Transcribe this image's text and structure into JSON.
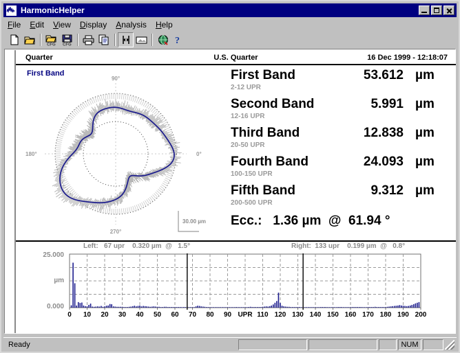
{
  "window": {
    "title": "HarmonicHelper",
    "icon": "waveform-app-icon",
    "buttons": {
      "minimize": "minimize",
      "maximize": "maximize",
      "close": "close"
    }
  },
  "menu": [
    {
      "label": "File",
      "accel": "F"
    },
    {
      "label": "Edit",
      "accel": "E"
    },
    {
      "label": "View",
      "accel": "V"
    },
    {
      "label": "Display",
      "accel": "D"
    },
    {
      "label": "Analysis",
      "accel": "A"
    },
    {
      "label": "Help",
      "accel": "H"
    }
  ],
  "toolbar": [
    {
      "name": "new-file-icon",
      "title": "New"
    },
    {
      "name": "open-file-icon",
      "title": "Open"
    },
    {
      "sep": true
    },
    {
      "name": "open-cfg-icon",
      "title": "Open CFG"
    },
    {
      "name": "save-cfg-icon",
      "title": "Save CFG"
    },
    {
      "sep": true
    },
    {
      "name": "print-icon",
      "title": "Print"
    },
    {
      "name": "copy-icon",
      "title": "Copy"
    },
    {
      "sep": true
    },
    {
      "name": "cursors-icon",
      "title": "Cursors",
      "pressed": true
    },
    {
      "name": "image-icon",
      "title": "Image"
    },
    {
      "sep": true
    },
    {
      "name": "globe-icon",
      "title": "Web"
    },
    {
      "name": "help-icon",
      "title": "Help"
    }
  ],
  "header": {
    "left": "Quarter",
    "center": "U.S. Quarter",
    "right": "16 Dec 1999 - 12:18:07"
  },
  "polar": {
    "title": "First Band",
    "angles": {
      "top": "90°",
      "left": "180°",
      "right": "0°",
      "bottom": "270°"
    },
    "scale_label": "30.00 µm"
  },
  "bands": [
    {
      "name": "First Band",
      "range": "2-12 UPR",
      "value": "53.612",
      "unit": "µm"
    },
    {
      "name": "Second Band",
      "range": "12-16 UPR",
      "value": "5.991",
      "unit": "µm"
    },
    {
      "name": "Third Band",
      "range": "20-50 UPR",
      "value": "12.838",
      "unit": "µm"
    },
    {
      "name": "Fourth Band",
      "range": "100-150 UPR",
      "value": "24.093",
      "unit": "µm"
    },
    {
      "name": "Fifth Band",
      "range": "200-500 UPR",
      "value": "9.312",
      "unit": "µm"
    }
  ],
  "eccentricity": "Ecc.:   1.36 µm  @  61.94 °",
  "spectrum": {
    "left_cursor_text": "Left:   67 upr    0.320 µm  @   1.5°",
    "right_cursor_text": "Right:  133 upr    0.199 µm  @   0.8°",
    "left_cursor_upr": 67,
    "right_cursor_upr": 133
  },
  "chart_data": {
    "type": "bar",
    "title": "Harmonic amplitude spectrum",
    "xlabel": "UPR",
    "ylabel": "µm",
    "xlim": [
      0,
      200
    ],
    "ylim": [
      0,
      25
    ],
    "yticks": [
      0.0,
      25.0
    ],
    "ytick_labels": [
      "0.000",
      "25.000"
    ],
    "xticks": [
      0,
      10,
      20,
      30,
      40,
      50,
      60,
      70,
      80,
      90,
      100,
      110,
      120,
      130,
      140,
      150,
      160,
      170,
      180,
      190,
      200
    ],
    "grid": true,
    "cursors": [
      67,
      133
    ],
    "x": [
      1,
      2,
      3,
      4,
      5,
      6,
      7,
      8,
      9,
      10,
      11,
      12,
      13,
      14,
      15,
      16,
      17,
      18,
      19,
      20,
      21,
      22,
      23,
      24,
      25,
      26,
      27,
      28,
      29,
      30,
      31,
      32,
      33,
      34,
      35,
      36,
      37,
      38,
      39,
      40,
      41,
      42,
      43,
      44,
      45,
      46,
      47,
      48,
      49,
      50,
      51,
      52,
      53,
      54,
      55,
      56,
      57,
      58,
      59,
      60,
      61,
      62,
      63,
      64,
      65,
      66,
      67,
      68,
      69,
      70,
      71,
      72,
      73,
      74,
      75,
      76,
      77,
      78,
      79,
      80,
      81,
      82,
      83,
      84,
      85,
      86,
      87,
      88,
      89,
      90,
      91,
      92,
      93,
      94,
      95,
      96,
      97,
      98,
      99,
      100,
      101,
      102,
      103,
      104,
      105,
      106,
      107,
      108,
      109,
      110,
      111,
      112,
      113,
      114,
      115,
      116,
      117,
      118,
      119,
      120,
      121,
      122,
      123,
      124,
      125,
      126,
      127,
      128,
      129,
      130,
      131,
      132,
      133,
      134,
      135,
      136,
      137,
      138,
      139,
      140,
      141,
      142,
      143,
      144,
      145,
      146,
      147,
      148,
      149,
      150,
      151,
      152,
      153,
      154,
      155,
      156,
      157,
      158,
      159,
      160,
      161,
      162,
      163,
      164,
      165,
      166,
      167,
      168,
      169,
      170,
      171,
      172,
      173,
      174,
      175,
      176,
      177,
      178,
      179,
      180,
      181,
      182,
      183,
      184,
      185,
      186,
      187,
      188,
      189,
      190,
      191,
      192,
      193,
      194,
      195,
      196,
      197,
      198,
      199,
      200
    ],
    "values": [
      1.1,
      21.0,
      11.4,
      1.0,
      2.6,
      2.2,
      2.4,
      1.0,
      0.7,
      0.6,
      1.3,
      1.9,
      0.5,
      0.4,
      0.5,
      0.6,
      0.5,
      0.8,
      0.4,
      0.6,
      0.9,
      1.0,
      1.7,
      1.6,
      0.6,
      0.5,
      0.4,
      0.4,
      0.4,
      0.4,
      0.3,
      0.3,
      0.3,
      0.4,
      0.5,
      0.7,
      0.9,
      0.6,
      0.8,
      1.0,
      0.6,
      0.8,
      0.7,
      0.6,
      0.5,
      0.4,
      0.5,
      0.6,
      0.5,
      0.4,
      0.4,
      0.3,
      0.3,
      0.4,
      0.4,
      0.3,
      0.3,
      0.3,
      0.3,
      0.3,
      0.3,
      0.3,
      0.3,
      0.2,
      0.3,
      0.3,
      0.32,
      0.2,
      0.2,
      0.2,
      0.2,
      0.6,
      0.9,
      0.8,
      0.6,
      0.5,
      0.4,
      0.3,
      0.3,
      0.2,
      0.2,
      0.2,
      0.2,
      0.2,
      0.2,
      0.2,
      0.2,
      0.2,
      0.2,
      0.2,
      0.2,
      0.2,
      0.2,
      0.2,
      0.3,
      0.2,
      0.2,
      0.2,
      0.2,
      0.2,
      0.2,
      0.3,
      0.4,
      0.3,
      0.3,
      0.3,
      0.3,
      0.3,
      0.3,
      0.4,
      0.5,
      0.6,
      0.5,
      0.7,
      1.0,
      1.5,
      2.3,
      3.1,
      7.0,
      2.2,
      0.9,
      0.6,
      0.5,
      0.4,
      0.4,
      0.3,
      0.3,
      0.3,
      0.3,
      0.3,
      0.3,
      0.25,
      0.199,
      0.2,
      0.2,
      0.2,
      0.2,
      0.2,
      0.2,
      0.2,
      0.2,
      0.2,
      0.3,
      0.3,
      0.3,
      0.3,
      0.2,
      0.2,
      0.2,
      0.2,
      0.2,
      0.2,
      0.3,
      0.3,
      0.3,
      0.2,
      0.2,
      0.2,
      0.2,
      0.2,
      0.3,
      0.3,
      0.3,
      0.3,
      0.3,
      0.3,
      0.2,
      0.2,
      0.2,
      0.3,
      0.3,
      0.3,
      0.3,
      0.4,
      0.3,
      0.3,
      0.3,
      0.3,
      0.3,
      0.3,
      0.4,
      0.5,
      0.6,
      0.7,
      0.8,
      0.9,
      1.0,
      1.2,
      1.0,
      0.9,
      0.8,
      0.7,
      0.8,
      1.0,
      1.3,
      1.6,
      2.0,
      2.3,
      2.6
    ]
  },
  "status": {
    "ready": "Ready",
    "num": "NUM"
  },
  "colors": {
    "title_bar": "#000080",
    "trace": "#1a1a8c",
    "face": "#c0c0c0",
    "muted": "#9a9a9a"
  }
}
